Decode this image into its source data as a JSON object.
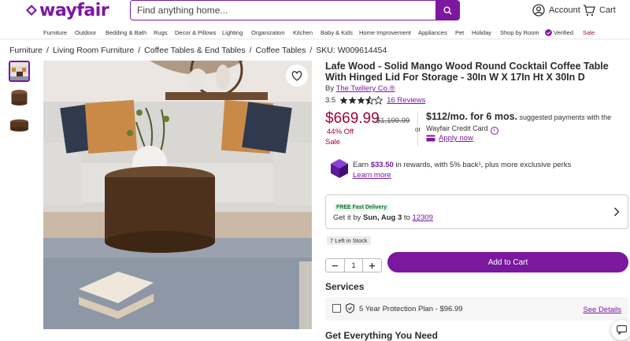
{
  "header": {
    "logo": "wayfair",
    "search_placeholder": "Find anything home...",
    "account_label": "Account",
    "cart_label": "Cart"
  },
  "nav": [
    "Furniture",
    "Outdoor",
    "Bedding & Bath",
    "Rugs",
    "Decor & Pillows",
    "Lighting",
    "Organization",
    "Kitchen",
    "Baby & Kids",
    "Home Improvement",
    "Appliances",
    "Pet",
    "Holiday",
    "Shop by Room",
    "Verified",
    "Sale"
  ],
  "breadcrumb": [
    "Furniture",
    "Living Room Furniture",
    "Coffee Tables & End Tables",
    "Coffee Tables",
    "SKU: W009614454"
  ],
  "product": {
    "title": "Lafe Wood - Solid Mango Wood Round Cocktail Coffee Table With Hinged Lid For Storage - 30In W X 17In Ht X 30In D",
    "by_label": "By",
    "brand": "The Twillery Co.®",
    "rating": "3.5",
    "reviews": "16 Reviews",
    "price": "$669.99",
    "old_price": "$1,199.99",
    "discount": "44% Off",
    "sale_label": "Sale",
    "or_label": "or",
    "monthly": "$112/mo. for 6 mos.",
    "monthly_note": "suggested payments with the Wayfair Credit Card",
    "apply_now": "Apply now",
    "rewards_prefix": "Earn",
    "rewards_amount": "$33.50",
    "rewards_suffix": "in rewards, with 5% back¹, plus more exclusive perks",
    "learn_more": "Learn more",
    "delivery_badge": "FREE Fast Delivery",
    "delivery_prefix": "Get it by",
    "delivery_date": "Sun, Aug 3",
    "delivery_to": "to",
    "zip": "12309",
    "stock": "7 Left in Stock",
    "quantity": "1",
    "add_to_cart": "Add to Cart",
    "services_heading": "Services",
    "protection_plan": "5 Year Protection Plan - $96.99",
    "see_details": "See Details",
    "everything_heading": "Get Everything You Need"
  },
  "colors": {
    "brand": "#7b189f",
    "sale": "#a3003b"
  },
  "icons": [
    "search-icon",
    "account-icon",
    "cart-icon",
    "verified-icon",
    "heart-icon",
    "star-icon",
    "info-icon",
    "credit-card-icon",
    "rewards-icon",
    "chevron-right-icon",
    "minus-icon",
    "plus-icon",
    "shield-icon",
    "chat-icon"
  ]
}
